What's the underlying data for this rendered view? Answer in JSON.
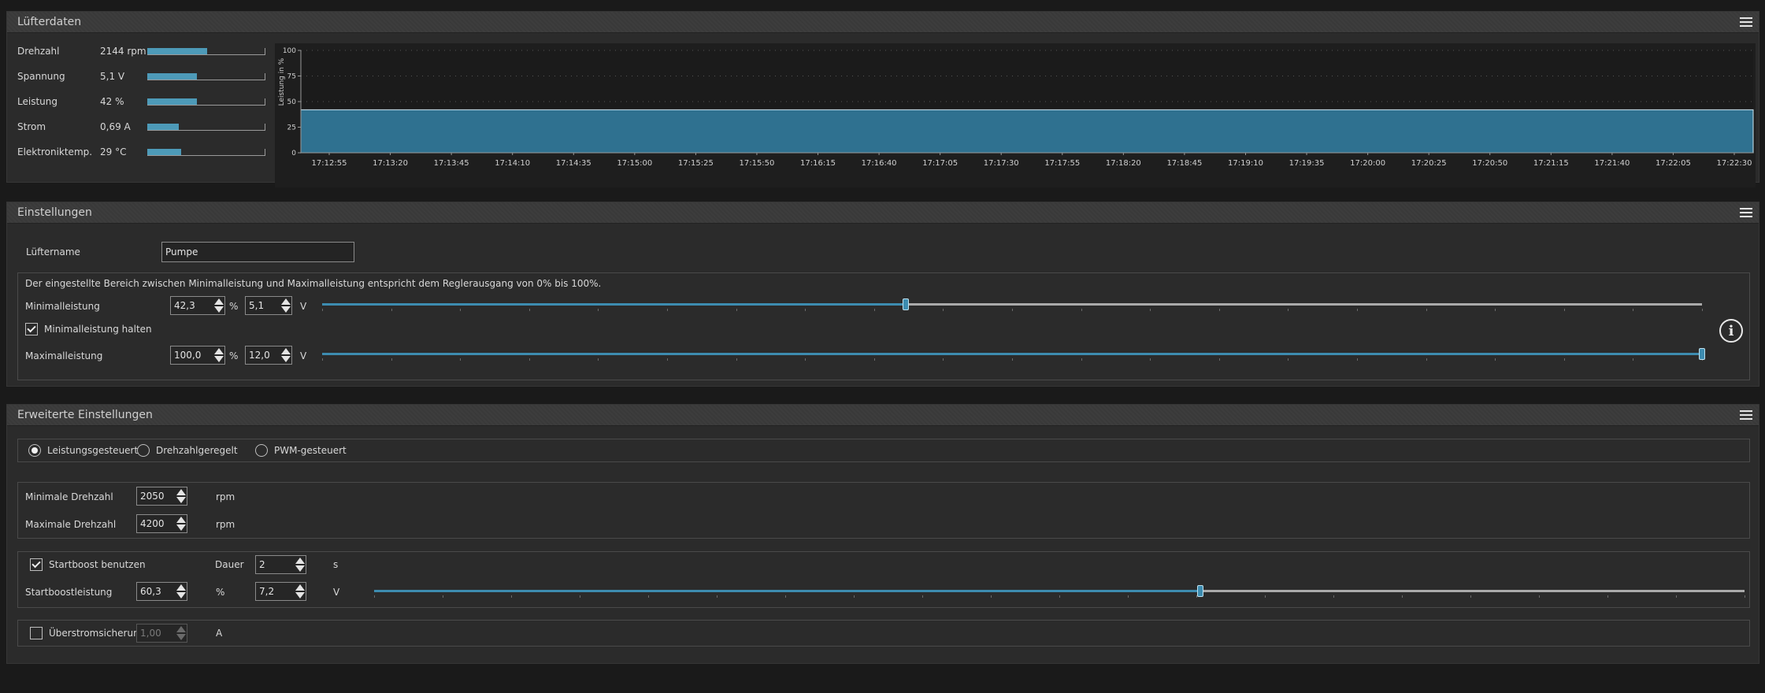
{
  "fan_data": {
    "title": "Lüfterdaten",
    "stats": [
      {
        "label": "Drehzahl",
        "value": "2144 rpm",
        "level": 0.51
      },
      {
        "label": "Spannung",
        "value": "5,1 V",
        "level": 0.42
      },
      {
        "label": "Leistung",
        "value": "42 %",
        "level": 0.42
      },
      {
        "label": "Strom",
        "value": "0,69 A",
        "level": 0.27
      },
      {
        "label": "Elektroniktemp.",
        "value": "29 °C",
        "level": 0.29
      }
    ]
  },
  "chart_data": {
    "type": "area",
    "ylabel": "Leistung in %",
    "ylim": [
      0,
      100
    ],
    "yticks": [
      "100",
      "75",
      "50",
      "25",
      "0"
    ],
    "x": [
      "17:12:55",
      "17:13:20",
      "17:13:45",
      "17:14:10",
      "17:14:35",
      "17:15:00",
      "17:15:25",
      "17:15:50",
      "17:16:15",
      "17:16:40",
      "17:17:05",
      "17:17:30",
      "17:17:55",
      "17:18:20",
      "17:18:45",
      "17:19:10",
      "17:19:35",
      "17:20:00",
      "17:20:25",
      "17:20:50",
      "17:21:15",
      "17:21:40",
      "17:22:05",
      "17:22:30"
    ],
    "values": [
      42,
      42,
      42,
      42,
      42,
      42,
      42,
      42,
      42,
      42,
      42,
      42,
      42,
      42,
      42,
      42,
      42,
      42,
      42,
      42,
      42,
      42,
      42,
      42
    ],
    "grid": true,
    "color": "#2f7190"
  },
  "settings": {
    "title": "Einstellungen",
    "fan_name_label": "Lüftername",
    "fan_name_value": "Pumpe",
    "range_note": "Der eingestellte Bereich zwischen Minimalleistung und Maximalleistung entspricht dem Reglerausgang von 0% bis 100%.",
    "min_label": "Minimalleistung",
    "min_percent": "42,3",
    "min_volt": "5,1",
    "min_slider": 0.423,
    "hold_min_label": "Minimalleistung halten",
    "max_label": "Maximalleistung",
    "max_percent": "100,0",
    "max_volt": "12,0",
    "max_slider": 1.0,
    "unit_percent": "%",
    "unit_volt": "V",
    "info_glyph": "i"
  },
  "advanced": {
    "title": "Erweiterte Einstellungen",
    "modes": [
      {
        "label": "Leistungsgesteuert",
        "selected": true
      },
      {
        "label": "Drehzahlgeregelt",
        "selected": false
      },
      {
        "label": "PWM-gesteuert",
        "selected": false
      }
    ],
    "min_rpm_label": "Minimale Drehzahl",
    "min_rpm_value": "2050",
    "max_rpm_label": "Maximale Drehzahl",
    "max_rpm_value": "4200",
    "rpm_unit": "rpm",
    "startboost_label": "Startboost benutzen",
    "duration_label": "Dauer",
    "duration_value": "2",
    "duration_unit": "s",
    "boost_label": "Startboostleistung",
    "boost_percent": "60,3",
    "boost_volt": "7,2",
    "boost_slider": 0.603,
    "overcurrent_label": "Überstromsicherung",
    "overcurrent_value": "1,00",
    "overcurrent_unit": "A"
  }
}
